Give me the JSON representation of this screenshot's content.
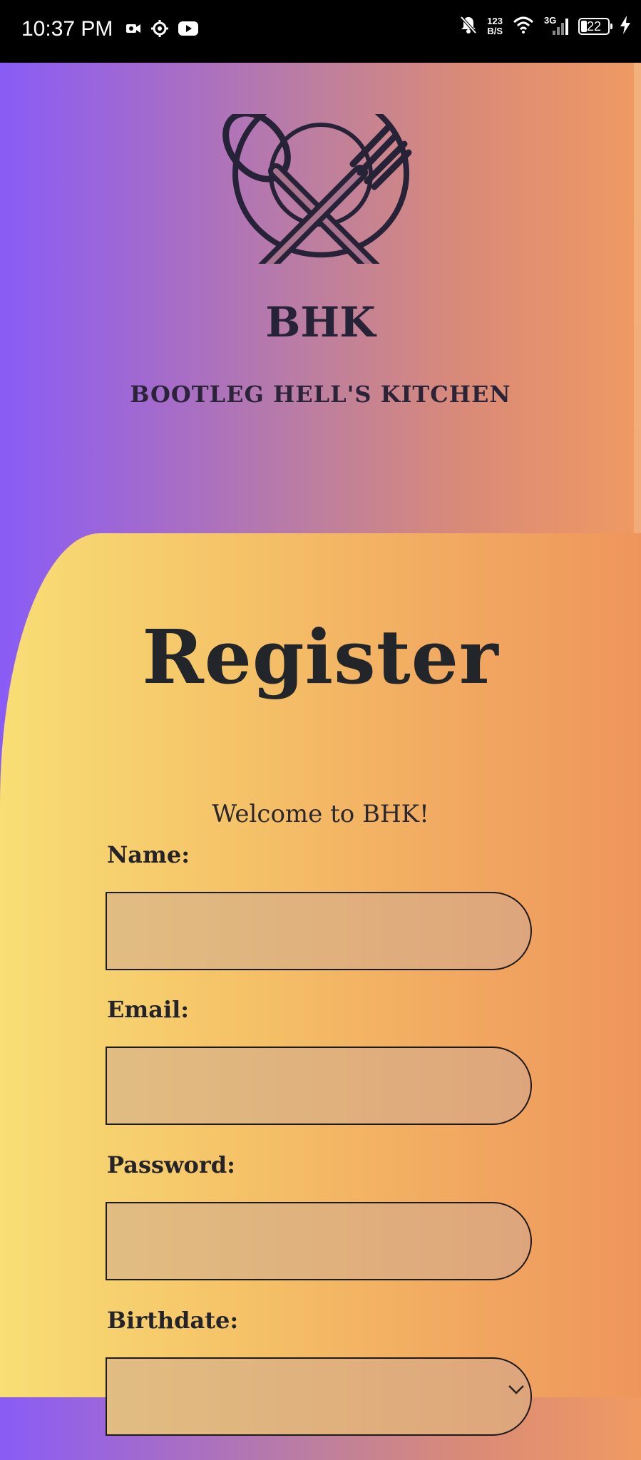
{
  "status_bar": {
    "time": "10:37 PM",
    "left_icons": [
      "video-camera-icon",
      "settings-gear-icon",
      "youtube-icon"
    ],
    "net_speed_value": "123",
    "net_speed_unit": "B/S",
    "network_type": "3G",
    "battery_level": "22",
    "right_icons": [
      "mute-bell-icon",
      "wifi-icon",
      "signal-icon",
      "battery-icon",
      "charging-bolt-icon"
    ]
  },
  "header": {
    "logo_icon": "spoon-fork-plate-icon",
    "logo_text": "BHK",
    "brand_name": "BOOTLEG HELL'S KITCHEN"
  },
  "form": {
    "title": "Register",
    "welcome": "Welcome to BHK!",
    "fields": [
      {
        "label": "Name:",
        "value": "",
        "placeholder": ""
      },
      {
        "label": "Email:",
        "value": "",
        "placeholder": ""
      },
      {
        "label": "Password:",
        "value": "",
        "placeholder": ""
      },
      {
        "label": "Birthdate:",
        "value": "",
        "placeholder": ""
      }
    ]
  },
  "colors": {
    "header_gradient_start": "#8a5cf6",
    "header_gradient_end": "#f09a62",
    "panel_gradient_start": "#f8de75",
    "panel_gradient_end": "#ef955c",
    "text_dark": "#22262b"
  }
}
